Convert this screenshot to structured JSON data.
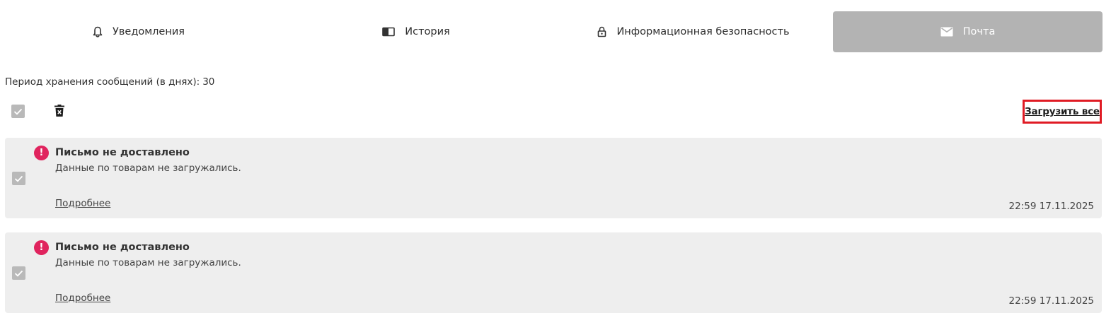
{
  "tabs": [
    {
      "label": "Уведомления",
      "icon": "bell-icon",
      "active": false
    },
    {
      "label": "История",
      "icon": "book-icon",
      "active": false
    },
    {
      "label": "Информационная безопасность",
      "icon": "lock-icon",
      "active": false
    },
    {
      "label": "Почта",
      "icon": "envelope-icon",
      "active": true
    }
  ],
  "period": {
    "label": "Период хранения сообщений (в днях):",
    "value": "30"
  },
  "toolbar": {
    "select_all_icon": "checkbox-icon",
    "delete_icon": "trash-icon",
    "load_all_label": "Загрузить все"
  },
  "messages": [
    {
      "title": "Письмо не доставлено",
      "text": "Данные по товарам не загружались.",
      "more_label": "Подробнее",
      "timestamp": "22:59 17.11.2025",
      "status_icon": "alert-icon"
    },
    {
      "title": "Письмо не доставлено",
      "text": "Данные по товарам не загружались.",
      "more_label": "Подробнее",
      "timestamp": "22:59 17.11.2025",
      "status_icon": "alert-icon"
    }
  ],
  "colors": {
    "active_tab": "#b3b3b3",
    "card_bg": "#eeeeee",
    "alert": "#e0245e",
    "highlight_border": "#e01b24"
  }
}
